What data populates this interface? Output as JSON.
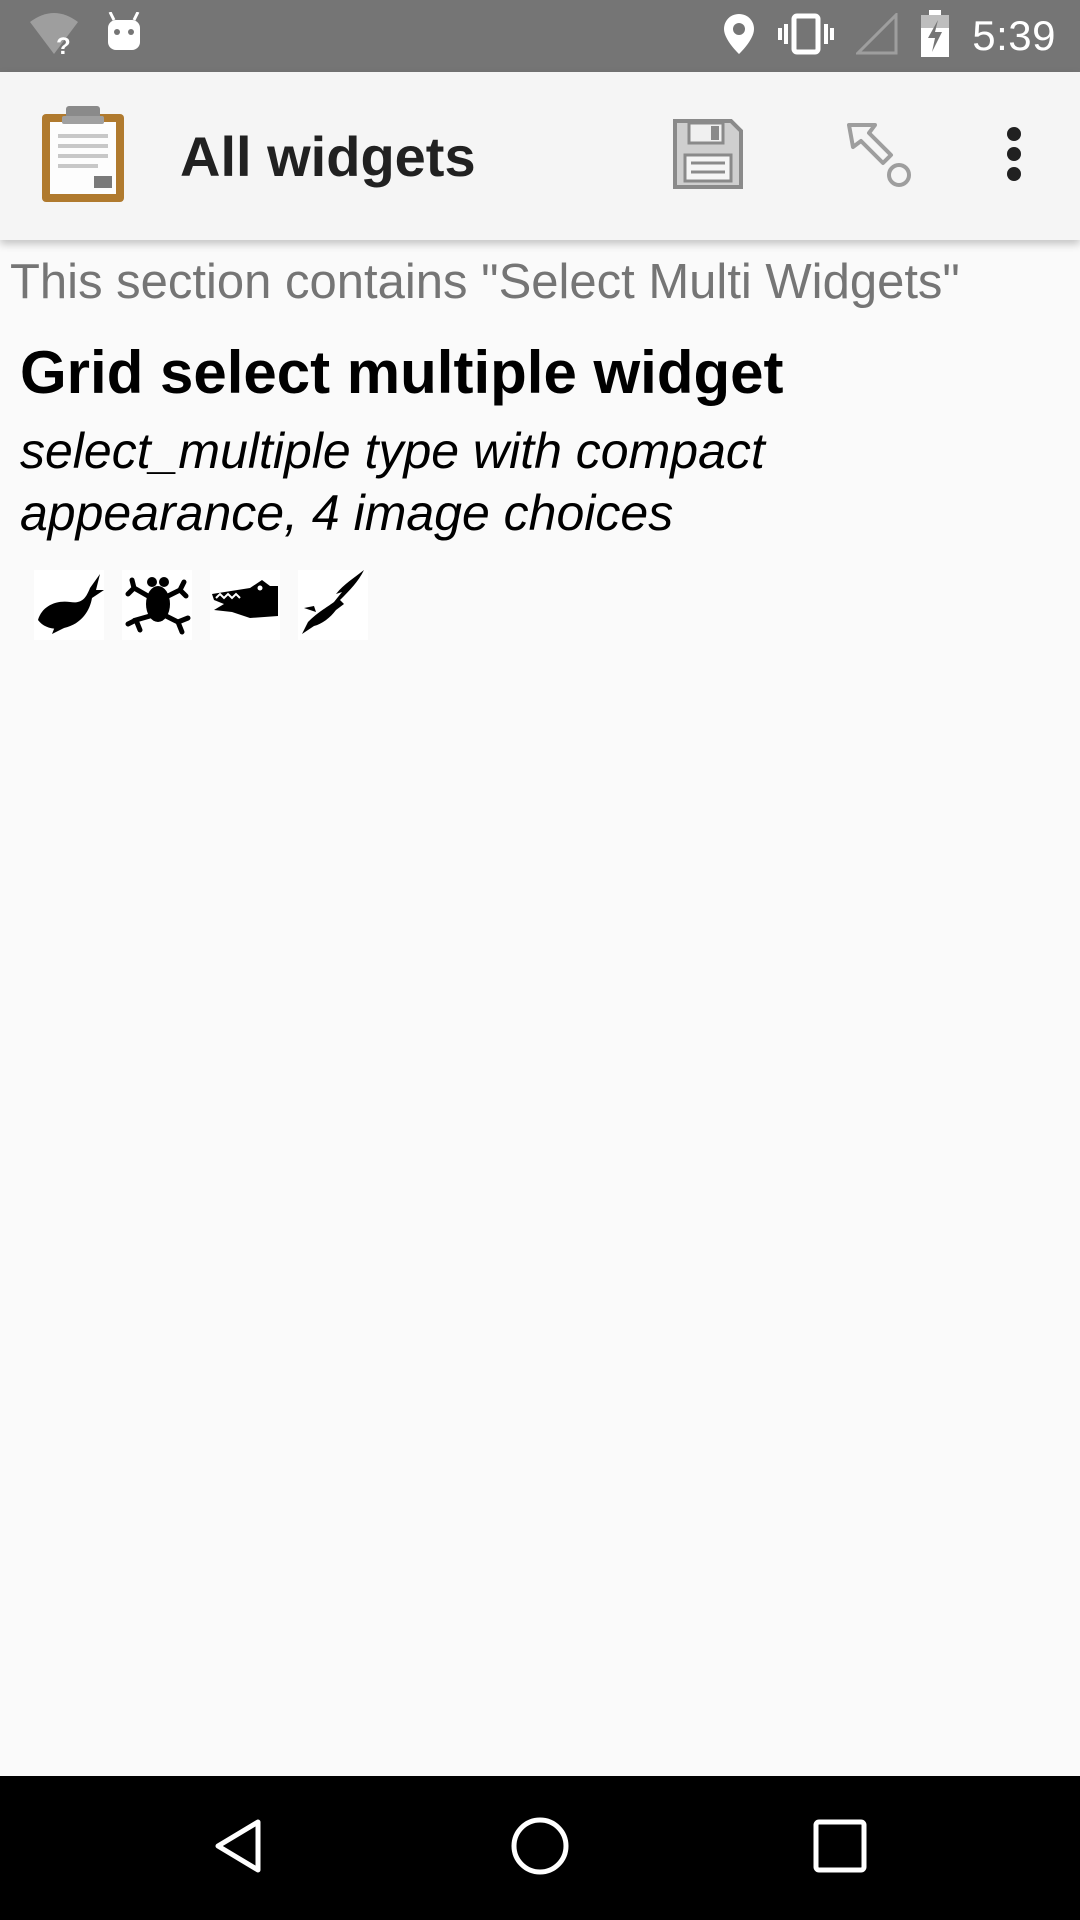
{
  "status_bar": {
    "time": "5:39",
    "icons": [
      "wifi-unknown-icon",
      "android-icon",
      "location-icon",
      "vibrate-icon",
      "signal-icon",
      "battery-charging-icon"
    ]
  },
  "toolbar": {
    "title": "All widgets",
    "icons": [
      "app-clipboard-icon",
      "save-icon",
      "go-to-icon",
      "overflow-menu-icon"
    ]
  },
  "form": {
    "section_text": "This section contains \"Select Multi Widgets\"",
    "question_label": "Grid select multiple widget",
    "question_hint": "select_multiple type with compact appearance, 4 image choices",
    "choices": [
      {
        "icon": "whale-icon"
      },
      {
        "icon": "frog-icon"
      },
      {
        "icon": "crocodile-icon"
      },
      {
        "icon": "eagle-icon"
      }
    ]
  },
  "nav_bar": {
    "icons": [
      "back-icon",
      "home-icon",
      "recents-icon"
    ]
  },
  "colors": {
    "status_bar": "#757575",
    "toolbar": "#f5f5f5",
    "background": "#fafafa",
    "nav_bar": "#000000",
    "section_text": "#757575"
  }
}
